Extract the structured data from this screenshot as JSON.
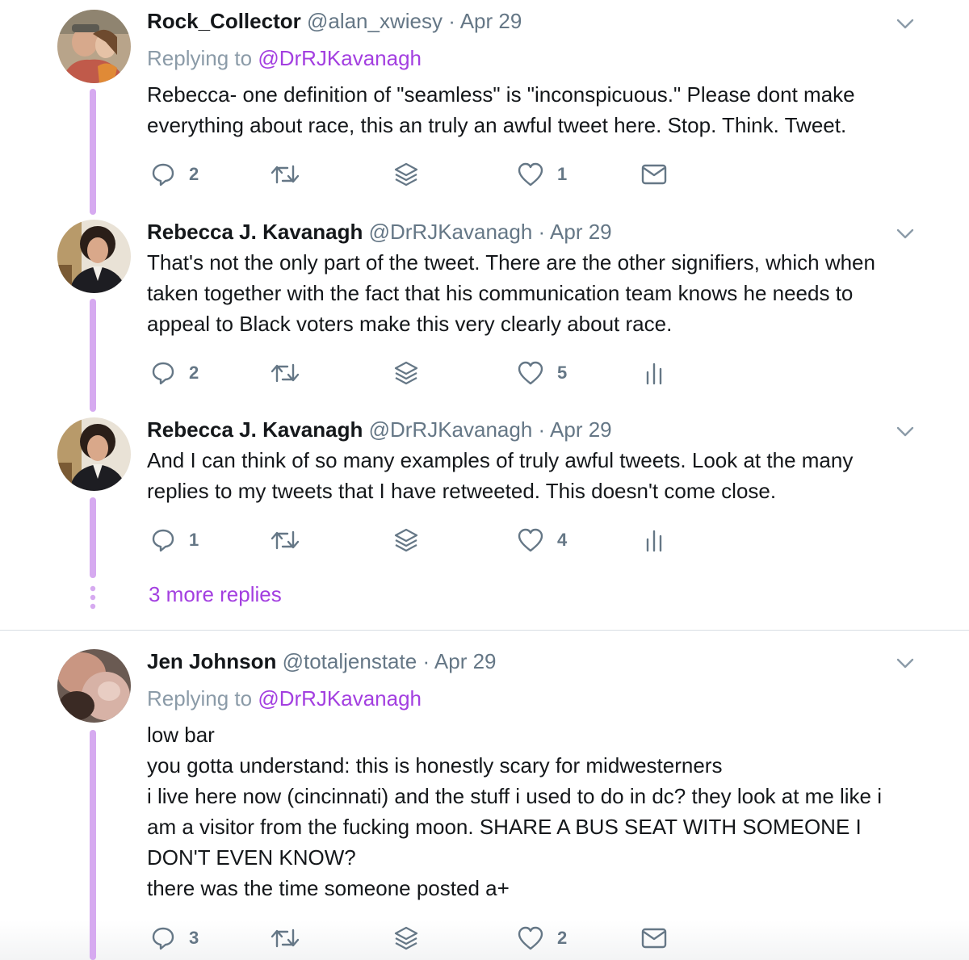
{
  "tweets": [
    {
      "name": "Rock_Collector",
      "handle": "@alan_xwiesy",
      "separator": "·",
      "date": "Apr 29",
      "replying_prefix": "Replying to",
      "replying_to": "@DrRJKavanagh",
      "text_lines": [
        "Rebecca- one definition of \"seamless\" is \"inconspicuous.\" Please dont make",
        "everything about race, this an truly an awful tweet here. Stop. Think. Tweet."
      ],
      "reply_count": "2",
      "like_count": "1",
      "last_action_icon": "envelope-icon"
    },
    {
      "name": "Rebecca J. Kavanagh",
      "handle": "@DrRJKavanagh",
      "separator": "·",
      "date": "Apr 29",
      "text_lines": [
        "That's not the only part of the tweet. There are the other signifiers, which when",
        "taken together with the fact that his communication team knows he needs to",
        "appeal to Black voters make this very clearly about race."
      ],
      "reply_count": "2",
      "like_count": "5",
      "last_action_icon": "analytics-icon"
    },
    {
      "name": "Rebecca J. Kavanagh",
      "handle": "@DrRJKavanagh",
      "separator": "·",
      "date": "Apr 29",
      "text_lines": [
        "And I can think of so many examples of truly awful tweets. Look at the many",
        "replies to my tweets that I have retweeted. This doesn't come close."
      ],
      "reply_count": "1",
      "like_count": "4",
      "last_action_icon": "analytics-icon"
    },
    {
      "name": "Jen Johnson",
      "handle": "@totaljenstate",
      "separator": "·",
      "date": "Apr 29",
      "replying_prefix": "Replying to",
      "replying_to": "@DrRJKavanagh",
      "text_lines": [
        "low bar",
        "you gotta understand: this is honestly scary for midwesterners",
        "i live here now (cincinnati) and the stuff i used to do in dc? they look at me like i",
        "am a visitor from the fucking moon. SHARE A BUS SEAT WITH SOMEONE I",
        "DON'T EVEN KNOW?",
        "there was the time someone posted a+"
      ],
      "reply_count": "3",
      "like_count": "2",
      "last_action_icon": "envelope-icon"
    }
  ],
  "more_replies": "3 more replies",
  "colors": {
    "accent": "#a33fe0",
    "thread_line": "#d6aaf0",
    "muted": "#657786",
    "icon": "#657786"
  }
}
